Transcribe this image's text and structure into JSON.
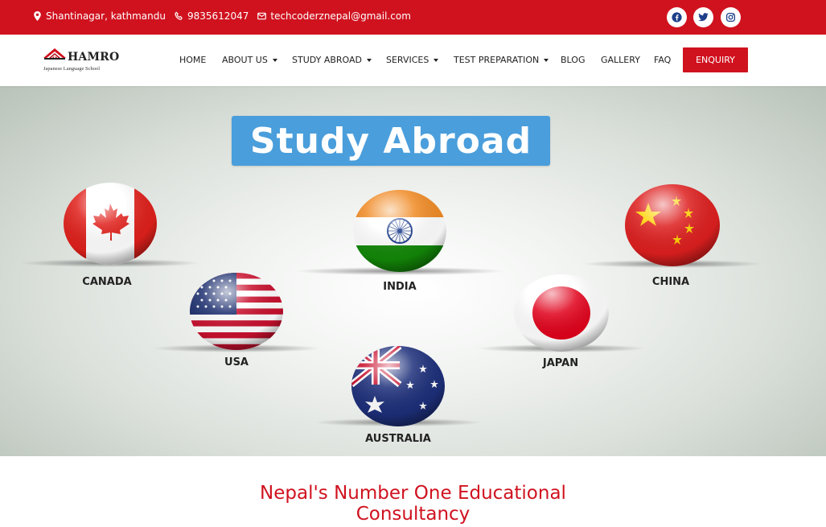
{
  "topbar": {
    "address": "Shantinagar, kathmandu",
    "phone": "9835612047",
    "email": "techcoderznepal@gmail.com",
    "social": [
      "facebook-icon",
      "twitter-icon",
      "instagram-icon"
    ]
  },
  "brand": {
    "name": "HAMRO",
    "tagline": "Japanese Language School"
  },
  "nav": {
    "items": [
      {
        "label": "HOME",
        "dropdown": false
      },
      {
        "label": "ABOUT US",
        "dropdown": true
      },
      {
        "label": "STUDY ABROAD",
        "dropdown": true
      },
      {
        "label": "SERVICES",
        "dropdown": true
      },
      {
        "label": "TEST PREPARATION",
        "dropdown": true
      },
      {
        "label": "BLOG",
        "dropdown": false
      },
      {
        "label": "GALLERY",
        "dropdown": false
      },
      {
        "label": "FAQ",
        "dropdown": false
      }
    ],
    "cta": "ENQUIRY"
  },
  "banner": {
    "title": "Study Abroad",
    "countries": [
      "CANADA",
      "INDIA",
      "CHINA",
      "USA",
      "JAPAN",
      "AUSTRALIA"
    ]
  },
  "section": {
    "heading_line1": "Nepal's Number One Educational",
    "heading_line2": "Consultancy"
  },
  "colors": {
    "brand_red": "#d0121f",
    "banner_blue": "#4a9edb"
  }
}
